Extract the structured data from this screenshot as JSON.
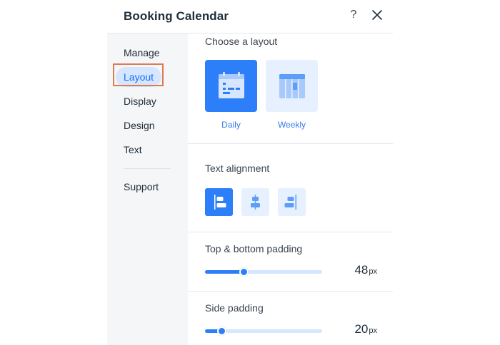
{
  "header": {
    "title": "Booking Calendar",
    "help_label": "?"
  },
  "sidebar": {
    "items": [
      {
        "label": "Manage",
        "selected": false
      },
      {
        "label": "Layout",
        "selected": true
      },
      {
        "label": "Display",
        "selected": false
      },
      {
        "label": "Design",
        "selected": false
      },
      {
        "label": "Text",
        "selected": false
      },
      {
        "label": "Support",
        "selected": false
      }
    ]
  },
  "content": {
    "layout_section": {
      "label": "Choose a layout",
      "options": [
        {
          "label": "Daily",
          "icon": "daily-calendar-icon",
          "selected": true
        },
        {
          "label": "Weekly",
          "icon": "weekly-calendar-icon",
          "selected": false
        }
      ]
    },
    "alignment_section": {
      "label": "Text alignment",
      "options": [
        {
          "name": "align-left",
          "icon": "align-left-icon",
          "selected": true
        },
        {
          "name": "align-center",
          "icon": "align-center-icon",
          "selected": false
        },
        {
          "name": "align-right",
          "icon": "align-right-icon",
          "selected": false
        }
      ]
    },
    "top_bottom_padding": {
      "label": "Top & bottom padding",
      "value": "48",
      "unit": "px",
      "fill_fraction": 0.33
    },
    "side_padding": {
      "label": "Side padding",
      "value": "20",
      "unit": "px",
      "fill_fraction": 0.14
    }
  },
  "colors": {
    "accent": "#116dff",
    "selected_fill": "#2d7ff9",
    "unselected_fill": "#e7f0fe",
    "nav_selected_bg": "#d6e6fe",
    "focus_ring": "#e07a55"
  }
}
